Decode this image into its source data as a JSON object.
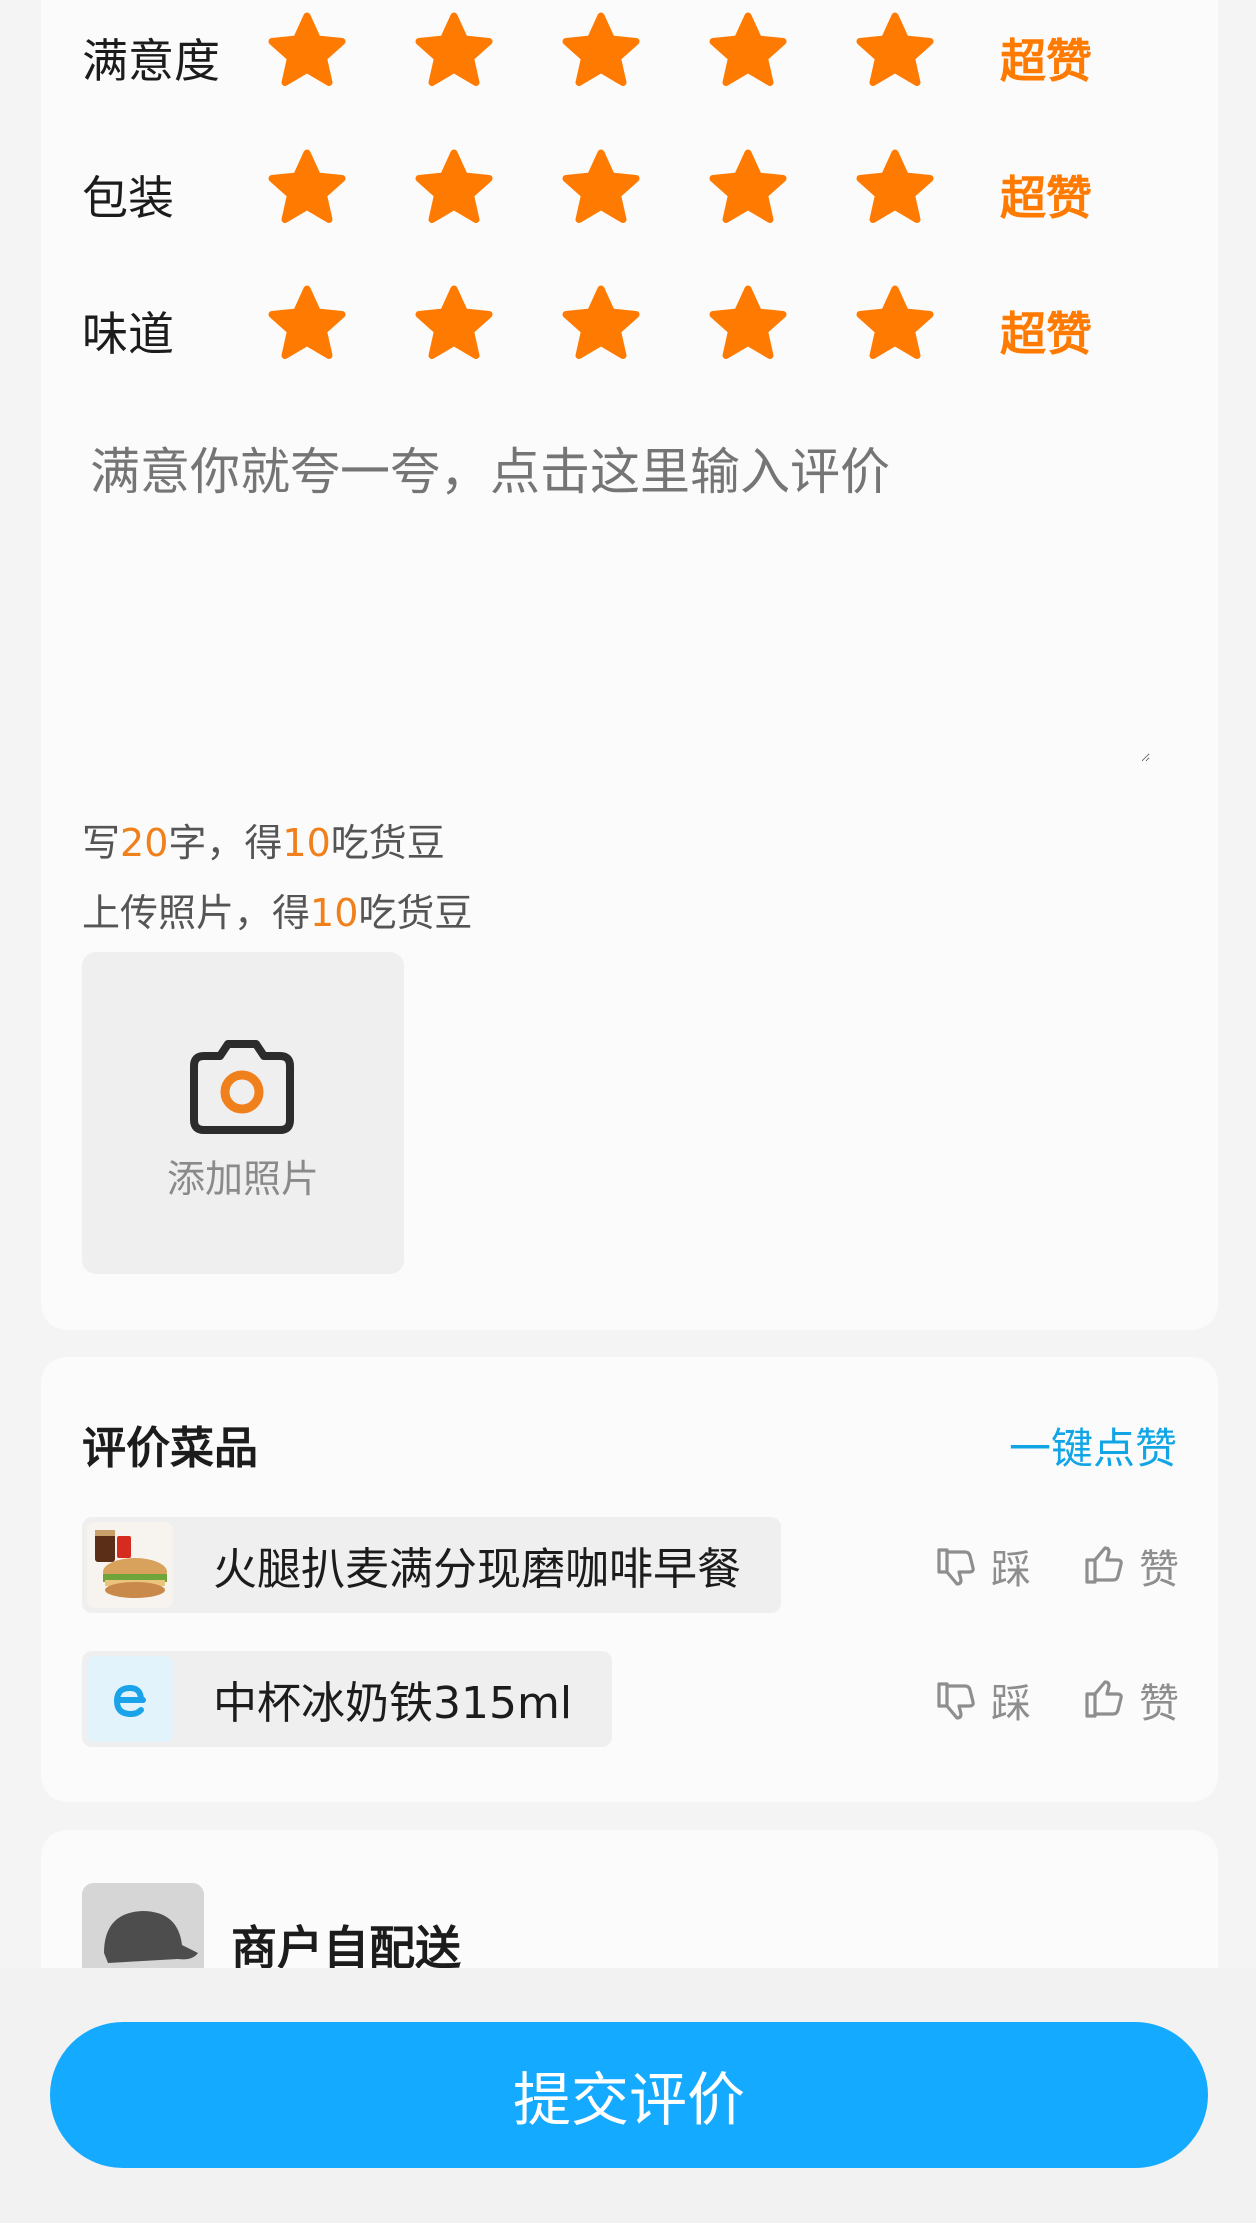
{
  "ratings": [
    {
      "label": "满意度",
      "stars": 5,
      "max": 5,
      "word": "超赞"
    },
    {
      "label": "包装",
      "stars": 5,
      "max": 5,
      "word": "超赞"
    },
    {
      "label": "味道",
      "stars": 5,
      "max": 5,
      "word": "超赞"
    }
  ],
  "review": {
    "placeholder": "满意你就夸一夸，点击这里输入评价"
  },
  "rewards": {
    "text_prefix": "写",
    "text_count": "20",
    "text_mid": "字，得",
    "text_beans": "10",
    "text_suffix": "吃货豆",
    "photo_prefix": "上传照片，得",
    "photo_beans": "10",
    "photo_suffix": "吃货豆"
  },
  "photo": {
    "label": "添加照片",
    "icon": "camera-icon"
  },
  "dishes": {
    "title": "评价菜品",
    "like_all": "一键点赞",
    "items": [
      {
        "name": "火腿扒麦满分现磨咖啡早餐",
        "thumb": "burger-coffee-thumb",
        "dislike": "踩",
        "like": "赞"
      },
      {
        "name": "中杯冰奶铁315ml",
        "thumb": "e-logo-thumb",
        "dislike": "踩",
        "like": "赞"
      }
    ]
  },
  "courier": {
    "name": "商户自配送",
    "avatar": "courier-avatar"
  },
  "submit": {
    "label": "提交评价"
  },
  "colors": {
    "star": "#ff7a00",
    "accent_orange": "#f0801b",
    "link_blue": "#12a5e6",
    "button_blue": "#14aaff"
  }
}
